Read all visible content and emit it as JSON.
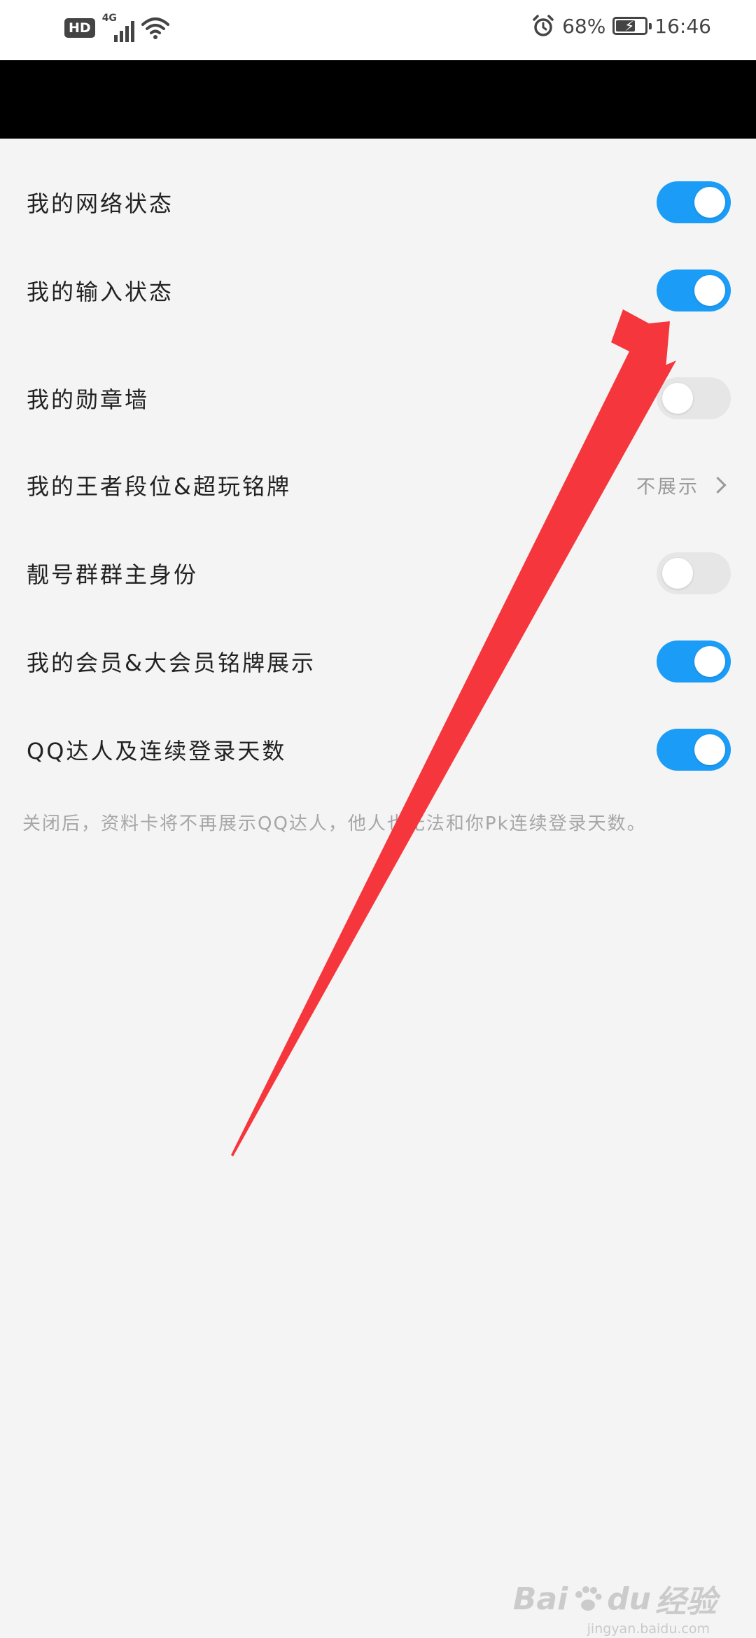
{
  "status_bar": {
    "hd_label": "HD",
    "network_label": "4G",
    "battery_percent": "68%",
    "battery_level": 0.68,
    "time": "16:46"
  },
  "settings": [
    {
      "label": "我的网络状态",
      "control": "toggle",
      "state": "on"
    },
    {
      "label": "我的输入状态",
      "control": "toggle",
      "state": "on"
    },
    {
      "label": "我的勋章墙",
      "control": "toggle",
      "state": "off"
    },
    {
      "label": "我的王者段位&超玩铭牌",
      "control": "link",
      "value": "不展示"
    },
    {
      "label": "靓号群群主身份",
      "control": "toggle",
      "state": "off"
    },
    {
      "label": "我的会员&大会员铭牌展示",
      "control": "toggle",
      "state": "on"
    },
    {
      "label": "QQ达人及连续登录天数",
      "control": "toggle",
      "state": "on"
    }
  ],
  "footnote": "关闭后，资料卡将不再展示QQ达人，他人也无法和你Pk连续登录天数。",
  "watermark": {
    "brand": "Bai",
    "brand2": "du",
    "suffix": "经验",
    "url": "jingyan.baidu.com"
  },
  "colors": {
    "toggle_on": "#1a9cf7",
    "toggle_off": "#e6e6e6",
    "arrow": "#f5363c",
    "background": "#f4f4f4"
  }
}
